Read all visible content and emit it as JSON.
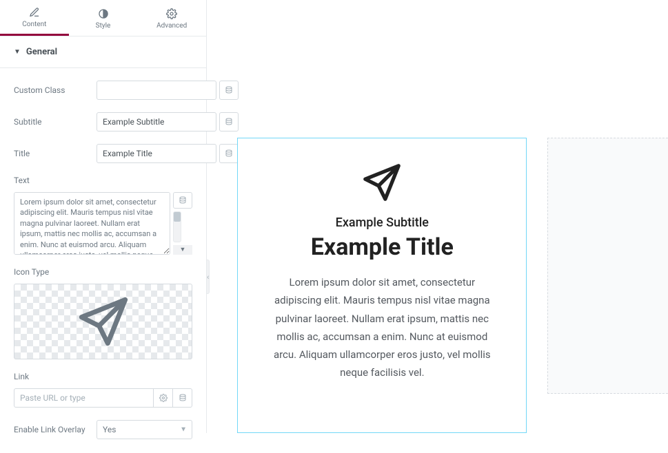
{
  "tabs": {
    "content": "Content",
    "style": "Style",
    "advanced": "Advanced"
  },
  "section": {
    "title": "General"
  },
  "fields": {
    "custom_class_label": "Custom Class",
    "custom_class_value": "",
    "subtitle_label": "Subtitle",
    "subtitle_value": "Example Subtitle",
    "title_label": "Title",
    "title_value": "Example Title",
    "text_label": "Text",
    "text_value": "Lorem ipsum dolor sit amet, consectetur adipiscing elit. Mauris tempus nisl vitae magna pulvinar laoreet. Nullam erat ipsum, mattis nec mollis ac, accumsan a enim. Nunc at euismod arcu. Aliquam ullamcorper eros justo, vel mollis neque facilisis vel.",
    "icon_type_label": "Icon Type",
    "link_label": "Link",
    "link_placeholder": "Paste URL or type",
    "link_value": "",
    "link_overlay_label": "Enable Link Overlay",
    "link_overlay_value": "Yes"
  },
  "preview": {
    "subtitle": "Example Subtitle",
    "title": "Example Title",
    "text": "Lorem ipsum dolor sit amet, consectetur adipiscing elit. Mauris tempus nisl vitae magna pulvinar laoreet. Nullam erat ipsum, mattis nec mollis ac, accumsan a enim. Nunc at euismod arcu. Aliquam ullamcorper eros justo, vel mollis neque facilisis vel."
  }
}
